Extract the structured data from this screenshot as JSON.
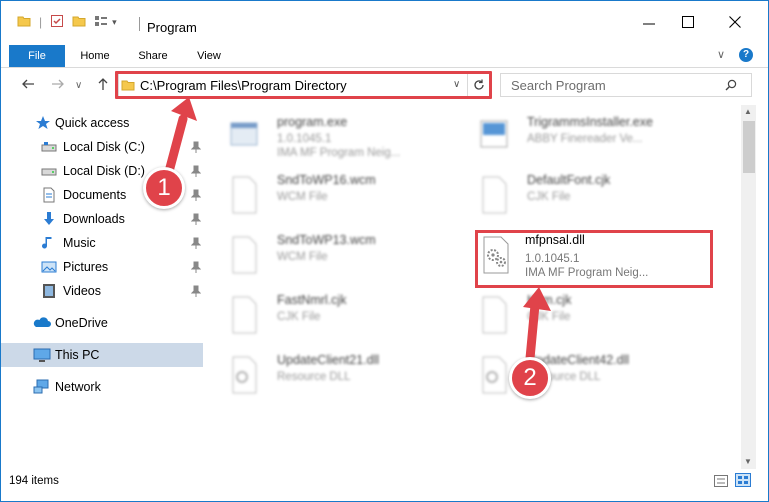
{
  "window": {
    "title": "Program",
    "minimize_label": "—",
    "maximize_label": "☐",
    "close_label": "✕"
  },
  "ribbon": {
    "tabs": [
      "File",
      "Home",
      "Share",
      "View"
    ],
    "help_label": "?"
  },
  "address_bar": {
    "path": "C:\\Program Files\\Program Directory",
    "search_placeholder": "Search Program"
  },
  "nav_pane": {
    "items": [
      {
        "label": "Quick access",
        "icon": "star-icon"
      },
      {
        "label": "Local Disk (C:)",
        "icon": "drive-icon",
        "pinned": true
      },
      {
        "label": "Local Disk (D:)",
        "icon": "drive-icon",
        "pinned": true
      },
      {
        "label": "Documents",
        "icon": "documents-icon",
        "pinned": true
      },
      {
        "label": "Downloads",
        "icon": "downloads-icon",
        "pinned": true
      },
      {
        "label": "Music",
        "icon": "music-icon",
        "pinned": true
      },
      {
        "label": "Pictures",
        "icon": "pictures-icon",
        "pinned": true
      },
      {
        "label": "Videos",
        "icon": "videos-icon",
        "pinned": true
      },
      {
        "label": "OneDrive",
        "icon": "onedrive-icon"
      },
      {
        "label": "This PC",
        "icon": "this-pc-icon",
        "selected": true
      },
      {
        "label": "Network",
        "icon": "network-icon"
      }
    ]
  },
  "files": [
    {
      "name": "program.exe",
      "line2": "1.0.1045.1",
      "line3": "IMA MF Program Neig...",
      "icon": "exe-icon"
    },
    {
      "name": "Trigramms­Installer.exe",
      "line2": "ABBY Finereader Ve...",
      "line3": "",
      "icon": "installer-icon"
    },
    {
      "name": "SndToWP16.wcm",
      "line2": "WCM File",
      "line3": "",
      "icon": "generic-file-icon"
    },
    {
      "name": "DefaultFont.cjk",
      "line2": "CJK File",
      "line3": "",
      "icon": "generic-file-icon"
    },
    {
      "name": "SndToWP13.wcm",
      "line2": "WCM File",
      "line3": "",
      "icon": "generic-file-icon"
    },
    {
      "name": "mfpnsal.dll",
      "line2": "1.0.1045.1",
      "line3": "IMA MF Program Neig...",
      "icon": "dll-icon",
      "highlighted": true
    },
    {
      "name": "FastNmrl.cjk",
      "line2": "CJK File",
      "line3": "",
      "icon": "generic-file-icon"
    },
    {
      "name": "Kom.cjk",
      "line2": "CJK File",
      "line3": "",
      "icon": "generic-file-icon"
    },
    {
      "name": "UpdateClient21.dll",
      "line2": "Resource DLL",
      "line3": "",
      "icon": "dll-icon"
    },
    {
      "name": "UpdateClient42.dll",
      "line2": "Resource DLL",
      "line3": "",
      "icon": "dll-icon"
    }
  ],
  "status_bar": {
    "item_count": "194 items"
  },
  "callouts": [
    "1",
    "2"
  ],
  "colors": {
    "accent": "#1979ca",
    "highlight": "#e0434a",
    "selected_nav": "#ccd9e8"
  }
}
